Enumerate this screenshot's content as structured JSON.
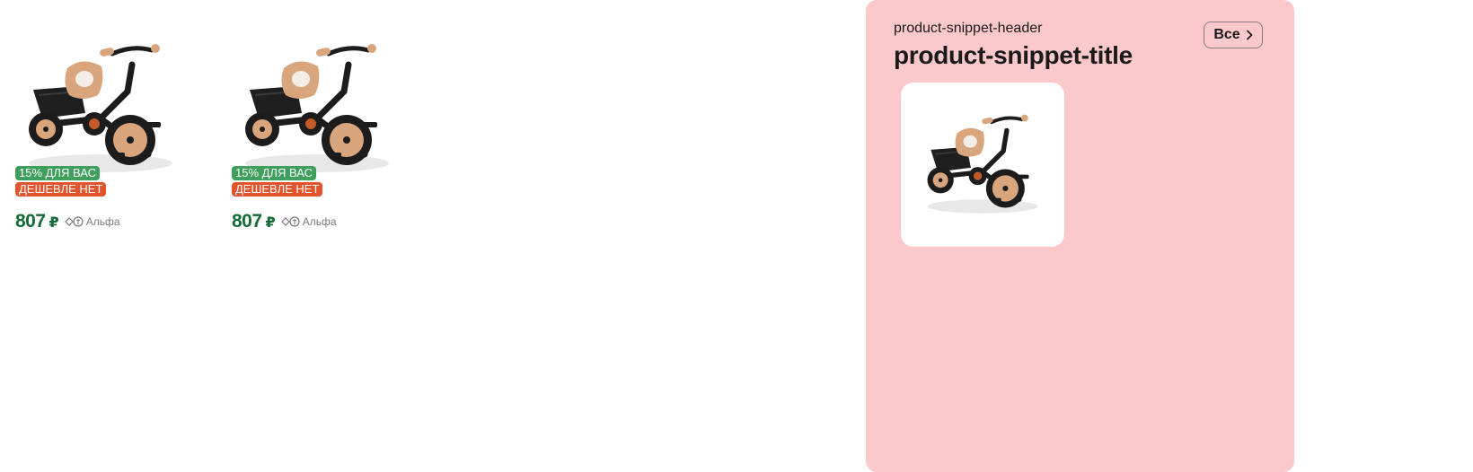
{
  "products": [
    {
      "image_icon": "tricycle-image",
      "badges": {
        "discount": "15% ДЛЯ ВАС",
        "cheaper": "ДЕШЕВЛЕ НЕТ"
      },
      "price": "807",
      "currency": "₽",
      "cashback_bank": "Альфа"
    },
    {
      "image_icon": "tricycle-image",
      "badges": {
        "discount": "15% ДЛЯ ВАС",
        "cheaper": "ДЕШЕВЛЕ НЕТ"
      },
      "price": "807",
      "currency": "₽",
      "cashback_bank": "Альфа"
    }
  ],
  "snippet": {
    "header": "product-snippet-header",
    "title": "product-snippet-title",
    "all_button_label": "Все",
    "tile_image_icon": "tricycle-image"
  },
  "colors": {
    "price_green": "#146b35",
    "discount_badge": "#3f9f5c",
    "cheaper_badge": "#e4532b",
    "snippet_background": "#fbc9cc"
  }
}
